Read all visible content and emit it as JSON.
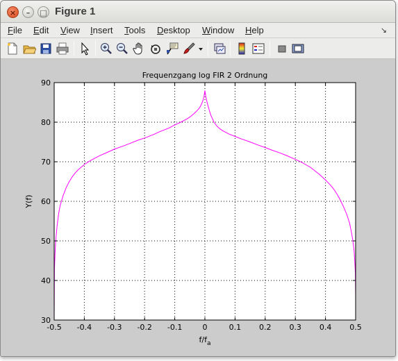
{
  "window": {
    "title": "Figure 1",
    "close_glyph": "×",
    "minimize_glyph": "–",
    "maximize_glyph": "□"
  },
  "menu": {
    "items": [
      "File",
      "Edit",
      "View",
      "Insert",
      "Tools",
      "Desktop",
      "Window",
      "Help"
    ],
    "dock_glyph": "↘"
  },
  "toolbar": {
    "icons": [
      "new-figure-icon",
      "open-file-icon",
      "save-icon",
      "print-icon",
      "edit-plot-arrow-icon",
      "zoom-in-icon",
      "zoom-out-icon",
      "pan-hand-icon",
      "rotate-3d-icon",
      "data-cursor-icon",
      "brush-icon",
      "brush-dropdown-icon",
      "link-plot-icon",
      "colorbar-icon",
      "legend-icon",
      "hide-plot-tools-icon",
      "show-plot-tools-icon"
    ]
  },
  "colors": {
    "plot_line": "#ff00ff",
    "figure_bg": "#cccccc",
    "axes_bg": "#ffffff"
  },
  "chart_data": {
    "type": "line",
    "title": "Frequenzgang log FIR 2 Ordnung",
    "xlabel": "f/f",
    "xlabel_sub": "a",
    "ylabel": "Y(f)",
    "xlim": [
      -0.5,
      0.5
    ],
    "ylim": [
      30,
      90
    ],
    "xticks": [
      "-0.5",
      "-0.4",
      "-0.3",
      "-0.2",
      "-0.1",
      "0",
      "0.1",
      "0.2",
      "0.3",
      "0.4",
      "0.5"
    ],
    "yticks": [
      "30",
      "40",
      "50",
      "60",
      "70",
      "80",
      "90"
    ],
    "grid": true,
    "series": [
      {
        "x": [
          -0.5,
          -0.499,
          -0.497,
          -0.495,
          -0.49,
          -0.485,
          -0.48,
          -0.47,
          -0.46,
          -0.45,
          -0.44,
          -0.43,
          -0.42,
          -0.4,
          -0.38,
          -0.35,
          -0.32,
          -0.3,
          -0.27,
          -0.25,
          -0.22,
          -0.2,
          -0.17,
          -0.15,
          -0.12,
          -0.1,
          -0.08,
          -0.06,
          -0.05,
          -0.04,
          -0.03,
          -0.02,
          -0.015,
          -0.01,
          -0.006,
          -0.003,
          -0.001,
          0,
          0.001,
          0.003,
          0.006,
          0.01,
          0.015,
          0.02,
          0.03,
          0.04,
          0.05,
          0.06,
          0.08,
          0.1,
          0.12,
          0.15,
          0.17,
          0.2,
          0.22,
          0.25,
          0.27,
          0.3,
          0.32,
          0.35,
          0.38,
          0.4,
          0.42,
          0.43,
          0.44,
          0.45,
          0.46,
          0.47,
          0.48,
          0.485,
          0.49,
          0.495,
          0.497,
          0.499,
          0.5
        ],
        "y": [
          30,
          43,
          47,
          50,
          54,
          57,
          59,
          61.5,
          63.5,
          65,
          66.2,
          67.2,
          68,
          69.3,
          70.3,
          71.5,
          72.5,
          73.2,
          74,
          74.6,
          75.5,
          76,
          76.9,
          77.6,
          78.5,
          79.3,
          80,
          80.8,
          81.3,
          81.9,
          82.6,
          83.4,
          84,
          84.8,
          85.6,
          86.5,
          87.5,
          88,
          87.5,
          86.5,
          85.4,
          84.2,
          82.9,
          81.7,
          80,
          79,
          78.3,
          77.8,
          77,
          76.4,
          75.8,
          75,
          74.4,
          73.6,
          73,
          72.2,
          71.6,
          70.6,
          69.9,
          68.6,
          66.8,
          65.4,
          63.8,
          62.8,
          61.6,
          60.2,
          58.6,
          56.8,
          54.5,
          52.6,
          50.5,
          47.5,
          45,
          42,
          36
        ]
      }
    ]
  }
}
